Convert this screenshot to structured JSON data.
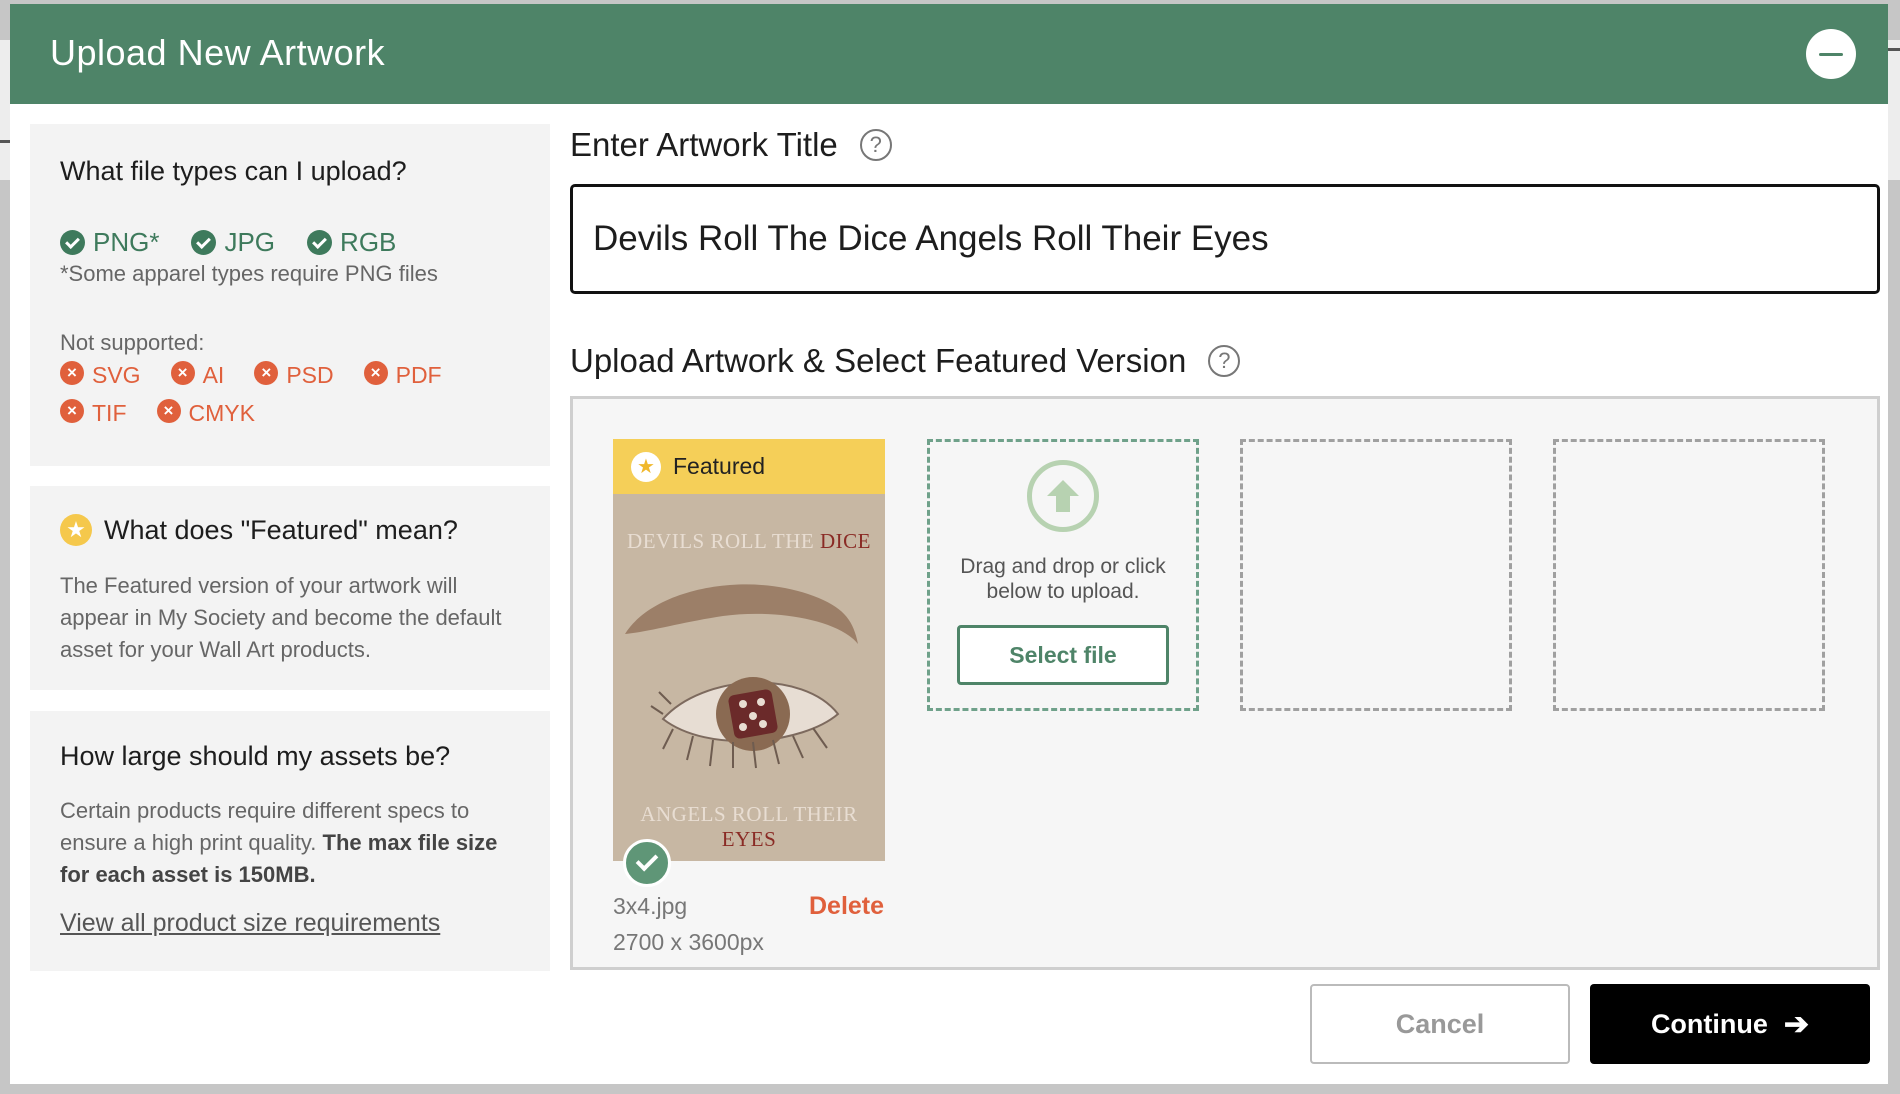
{
  "modal": {
    "title": "Upload New Artwork"
  },
  "file_types": {
    "heading": "What file types can I upload?",
    "supported": [
      "PNG*",
      "JPG",
      "RGB"
    ],
    "note": "*Some apparel types require PNG files",
    "not_supported_label": "Not supported:",
    "not_supported": [
      "SVG",
      "AI",
      "PSD",
      "PDF",
      "TIF",
      "CMYK"
    ]
  },
  "featured_info": {
    "heading": "What does \"Featured\" mean?",
    "body": "The Featured version of your artwork will appear in My Society and become the default asset for your Wall Art products."
  },
  "size_info": {
    "heading": "How large should my assets be?",
    "body_plain": "Certain products require different specs to ensure a high print quality.",
    "body_bold": "The max file size for each asset is 150MB.",
    "link": "View all product size requirements"
  },
  "title_field": {
    "label": "Enter Artwork Title",
    "value": "Devils Roll The Dice Angels Roll Their Eyes"
  },
  "upload_section": {
    "label": "Upload Artwork & Select Featured Version",
    "featured_label": "Featured",
    "artwork": {
      "top_text_light": "DEVILS ROLL THE ",
      "top_text_dark": "DICE",
      "bottom_text_light": "ANGELS ROLL THEIR ",
      "bottom_text_dark": "EYES"
    },
    "file_name": "3x4.jpg",
    "file_dims": "2700 x 3600px",
    "delete_label": "Delete",
    "drop_text_line1": "Drag and drop or click",
    "drop_text_line2": "below to upload.",
    "select_label": "Select file"
  },
  "footer": {
    "cancel_label": "Cancel",
    "continue_label": "Continue"
  },
  "colors": {
    "header_green": "#4e8468",
    "success_green": "#3e7a5c",
    "error_orange": "#e0603c",
    "featured_yellow": "#f5cf58"
  }
}
